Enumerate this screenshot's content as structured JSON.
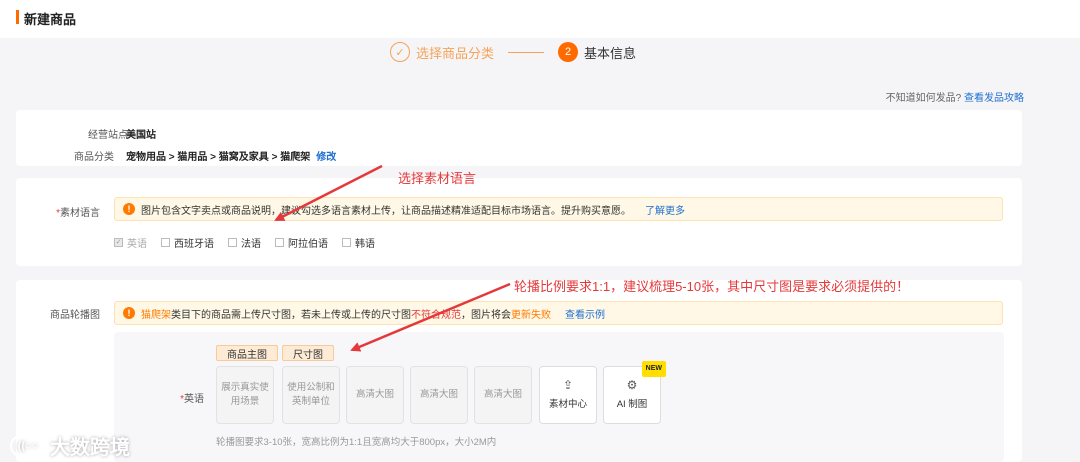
{
  "header": {
    "title": "新建商品"
  },
  "steps": [
    {
      "icon": "check-icon",
      "label": "选择商品分类",
      "state": "done"
    },
    {
      "number": "2",
      "label": "基本信息",
      "state": "active"
    }
  ],
  "help": {
    "text": "不知道如何发品?",
    "link": "查看发品攻略"
  },
  "basic": {
    "site_label": "经营站点",
    "site_value": "美国站",
    "category_label": "商品分类",
    "category_value": "宠物用品 > 猫用品 > 猫窝及家具 > 猫爬架",
    "category_edit": "修改"
  },
  "language": {
    "label": "素材语言",
    "alert_text": "图片包含文字卖点或商品说明，建议勾选多语言素材上传，让商品描述精准适配目标市场语言。提升购买意愿。",
    "alert_link": "了解更多",
    "options": [
      {
        "label": "英语",
        "checked": true,
        "disabled": true
      },
      {
        "label": "西班牙语",
        "checked": false
      },
      {
        "label": "法语",
        "checked": false
      },
      {
        "label": "阿拉伯语",
        "checked": false
      },
      {
        "label": "韩语",
        "checked": false
      }
    ]
  },
  "carousel": {
    "label": "商品轮播图",
    "alert_cat": "猫爬架",
    "alert_text1": "类目下的商品需上传尺寸图，若未上传或上传的尺寸图",
    "alert_red": "不符合规范",
    "alert_text2": "，图片将会",
    "alert_orange": "更新失败",
    "alert_link": "查看示例",
    "tags": [
      "商品主图",
      "尺寸图"
    ],
    "row_label": "英语",
    "slots": [
      "展示真实使用场景",
      "使用公制和英制单位",
      "高清大图",
      "高清大图",
      "高清大图"
    ],
    "material_button": "素材中心",
    "ai_button": "AI 制图",
    "ai_badge": "NEW",
    "note": "轮播图要求3-10张，宽高比例为1:1且宽高均大于800px，大小2M内"
  },
  "annotations": {
    "lang_hint": "选择素材语言",
    "carousel_hint": "轮播比例要求1:1，建议梳理5-10张，其中尺寸图是要求必须提供的！"
  },
  "watermark": {
    "logo_text": "大数跨境",
    "logo_mark": "((○○"
  },
  "colors": {
    "accent": "#ff6a00",
    "link": "#1f6fd1",
    "annotation": "#e4393c"
  }
}
